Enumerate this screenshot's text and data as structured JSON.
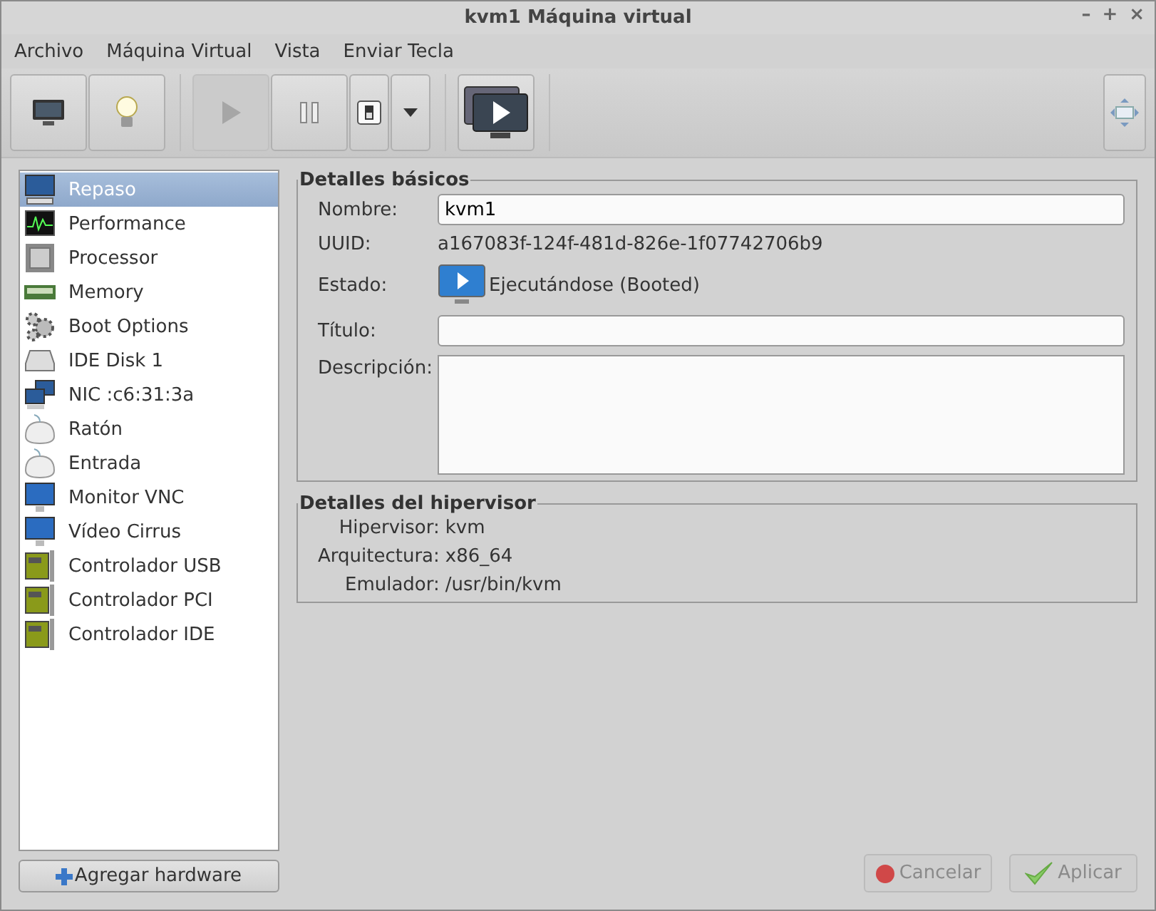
{
  "window": {
    "title": "kvm1 Máquina virtual",
    "controls": [
      "–",
      "+",
      "×"
    ]
  },
  "menu": [
    "Archivo",
    "Máquina Virtual",
    "Vista",
    "Enviar Tecla"
  ],
  "toolbar": [
    [
      {
        "kind": "console",
        "disabled": false
      },
      {
        "kind": "details",
        "disabled": false
      }
    ],
    [
      {
        "kind": "run",
        "disabled": true
      },
      {
        "kind": "pause",
        "disabled": false
      },
      {
        "kind": "shutdown",
        "disabled": false
      },
      {
        "kind": "caret",
        "disabled": false
      }
    ],
    [
      {
        "kind": "screens",
        "disabled": false
      }
    ],
    [
      {
        "kind": "resize",
        "disabled": false
      }
    ]
  ],
  "sidebar": {
    "items": [
      {
        "label": "Repaso",
        "kind": "monitor",
        "selected": true
      },
      {
        "label": "Performance",
        "kind": "performance",
        "selected": false
      },
      {
        "label": "Processor",
        "kind": "chip",
        "selected": false
      },
      {
        "label": "Memory",
        "kind": "memory",
        "selected": false
      },
      {
        "label": "Boot Options",
        "kind": "gears",
        "selected": false
      },
      {
        "label": "IDE Disk 1",
        "kind": "disk",
        "selected": false
      },
      {
        "label": "NIC :c6:31:3a",
        "kind": "network",
        "selected": false
      },
      {
        "label": "Ratón",
        "kind": "mouse",
        "selected": false
      },
      {
        "label": "Entrada",
        "kind": "mouse",
        "selected": false
      },
      {
        "label": "Monitor VNC",
        "kind": "display",
        "selected": false
      },
      {
        "label": "Vídeo Cirrus",
        "kind": "display",
        "selected": false
      },
      {
        "label": "Controlador USB",
        "kind": "card",
        "selected": false
      },
      {
        "label": "Controlador PCI",
        "kind": "card",
        "selected": false
      },
      {
        "label": "Controlador IDE",
        "kind": "card",
        "selected": false
      }
    ],
    "add_button": "Agregar hardware"
  },
  "basic": {
    "title": "Detalles básicos",
    "name_label": "Nombre:",
    "name_value": "kvm1",
    "uuid_label": "UUID:",
    "uuid_value": "a167083f-124f-481d-826e-1f07742706b9",
    "state_label": "Estado:",
    "state_value": "Ejecutándose (Booted)",
    "title_label": "Título:",
    "description_label": "Descripción:"
  },
  "hypervisor": {
    "title": "Detalles del hipervisor",
    "rows": [
      {
        "label": "Hipervisor:",
        "value": "kvm"
      },
      {
        "label": "Arquitectura:",
        "value": "x86_64"
      },
      {
        "label": "Emulador:",
        "value": "/usr/bin/kvm"
      }
    ]
  },
  "buttons": [
    {
      "label": "Cancelar",
      "kind": "cancel",
      "disabled": true
    },
    {
      "label": "Aplicar",
      "kind": "apply",
      "disabled": true
    }
  ]
}
